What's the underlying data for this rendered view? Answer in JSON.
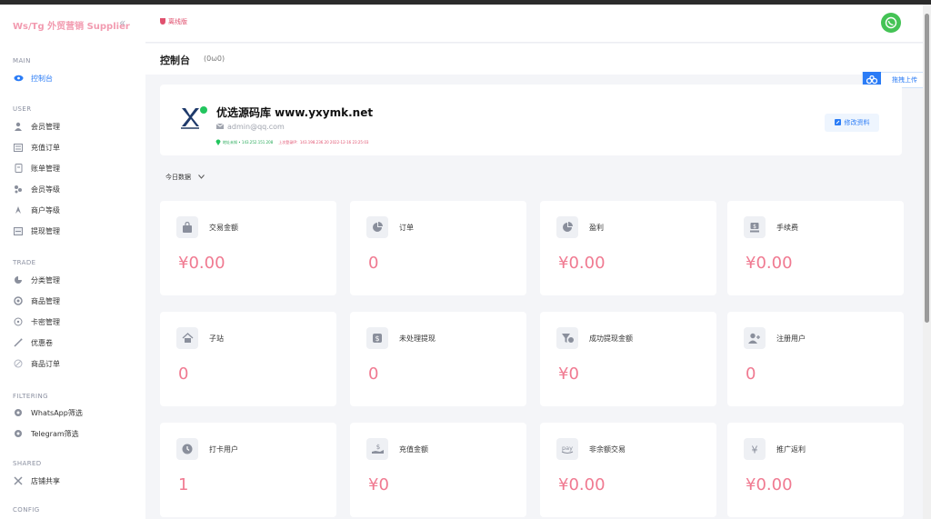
{
  "brand": "Ws/Tg 外贸营销 Supplier",
  "sidebar": {
    "sections": [
      {
        "title": "MAIN",
        "items": [
          {
            "label": "控制台",
            "icon": "eye-icon",
            "active": true
          }
        ]
      },
      {
        "title": "USER",
        "items": [
          {
            "label": "会员管理",
            "icon": "user-icon"
          },
          {
            "label": "充值订单",
            "icon": "list-icon"
          },
          {
            "label": "账单管理",
            "icon": "bill-icon"
          },
          {
            "label": "会员等级",
            "icon": "tier-icon"
          },
          {
            "label": "商户等级",
            "icon": "merchant-icon"
          },
          {
            "label": "提现管理",
            "icon": "withdraw-icon"
          }
        ]
      },
      {
        "title": "TRADE",
        "items": [
          {
            "label": "分类管理",
            "icon": "category-icon"
          },
          {
            "label": "商品管理",
            "icon": "product-icon"
          },
          {
            "label": "卡密管理",
            "icon": "card-key-icon"
          },
          {
            "label": "优惠卷",
            "icon": "coupon-icon"
          },
          {
            "label": "商品订单",
            "icon": "order-icon"
          }
        ]
      },
      {
        "title": "FILTERING",
        "items": [
          {
            "label": "WhatsApp筛选",
            "icon": "radio-icon"
          },
          {
            "label": "Telegram筛选",
            "icon": "radio-icon"
          }
        ]
      },
      {
        "title": "SHARED",
        "items": [
          {
            "label": "店铺共享",
            "icon": "share-icon"
          }
        ]
      },
      {
        "title": "CONFIG",
        "items": []
      }
    ]
  },
  "topbar": {
    "offline_label": "离线版"
  },
  "header": {
    "title": "控制台",
    "subtitle": "(0ω0)"
  },
  "drag_upload": "拖拽上传",
  "profile": {
    "name": "优选源码库 www.yxymk.net",
    "email": "admin@qq.com",
    "ip_info": "地址未知 • 143.252.151.208",
    "last_login": "上次登录IP：143.198.236.20 2022-12-16 23:25:03",
    "edit_label": "修改资料"
  },
  "date_filter": "今日数据",
  "stats": [
    {
      "label": "交易金额",
      "value": "¥0.00",
      "icon": "bag-icon"
    },
    {
      "label": "订单",
      "value": "0",
      "icon": "pie-chart-icon"
    },
    {
      "label": "盈利",
      "value": "¥0.00",
      "icon": "pie-chart-icon"
    },
    {
      "label": "手续费",
      "value": "¥0.00",
      "icon": "money-icon"
    },
    {
      "label": "子站",
      "value": "0",
      "icon": "house-icon"
    },
    {
      "label": "未处理提现",
      "value": "0",
      "icon": "dollar-icon"
    },
    {
      "label": "成功提现金额",
      "value": "¥0",
      "icon": "funnel-dollar-icon"
    },
    {
      "label": "注册用户",
      "value": "0",
      "icon": "user-plus-icon"
    },
    {
      "label": "打卡用户",
      "value": "1",
      "icon": "clock-icon"
    },
    {
      "label": "充值金额",
      "value": "¥0",
      "icon": "hand-dollar-icon"
    },
    {
      "label": "非余额交易",
      "value": "¥0.00",
      "icon": "pay-icon"
    },
    {
      "label": "推广返利",
      "value": "¥0.00",
      "icon": "yen-icon"
    }
  ],
  "colors": {
    "accent": "#2b7cf6",
    "value": "#f07a91",
    "brand": "#f29bb0"
  }
}
